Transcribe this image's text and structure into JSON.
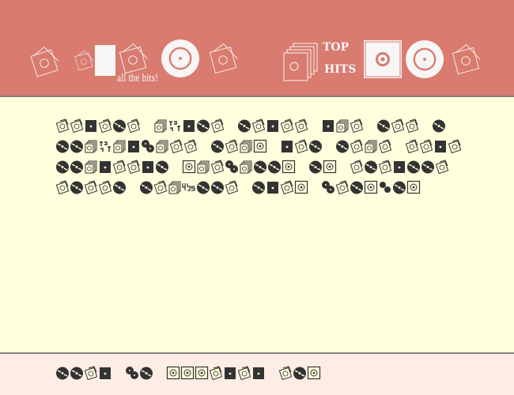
{
  "colors": {
    "header": "#d97b6f",
    "body": "#fffedd",
    "footer": "#feede4",
    "glyph": "#333333",
    "header_glyph": "#f7f5f5"
  },
  "header": {
    "logo_left_text": "all the hits!",
    "logo_right_text": "TOP HITS",
    "left_glyphs": "sbssr s",
    "right_glyphs": "tTwrs"
  },
  "specimen": {
    "rows": [
      "ssbsrs tTbrs rsbss bts rss r",
      "rrtTtbZtss rstw bsr rsts ssbs",
      "rrtbssbr wtsZtrrw rw srsbrrs",
      "srssr rstFrrs rbsw Zsrwzrw"
    ],
    "footer_row": "rrsb Zr wwwsbsb srw"
  }
}
